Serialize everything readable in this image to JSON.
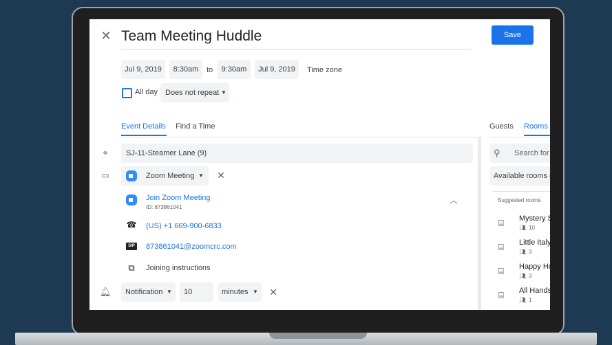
{
  "event": {
    "title": "Team Meeting Huddle",
    "save_label": "Save"
  },
  "datetime": {
    "start_date": "Jul 9, 2019",
    "start_time": "8:30am",
    "to_label": "to",
    "end_time": "9:30am",
    "end_date": "Jul 9, 2019",
    "timezone_label": "Time zone",
    "allday_label": "All day",
    "repeat_value": "Does not repeat"
  },
  "tabs": {
    "details": "Event Details",
    "find_time": "Find a Time"
  },
  "location": {
    "value": "SJ-11-Steamer Lane (9)"
  },
  "conference": {
    "type": "Zoom Meeting",
    "join_label": "Join Zoom Meeting",
    "meeting_id": "ID: 873861041",
    "phone": "(US) +1 669-900-6833",
    "sip": "873861041@zoomcrc.com",
    "sip_badge": "SIP",
    "instructions": "Joining instructions"
  },
  "notification": {
    "type": "Notification",
    "amount": "10",
    "unit": "minutes"
  },
  "right_panel": {
    "tab_guests": "Guests",
    "tab_rooms": "Rooms",
    "search_placeholder": "Search for",
    "available_rooms": "Available rooms c",
    "suggested_heading": "Suggested rooms",
    "rooms": [
      {
        "name": "Mystery S",
        "capacity": "10"
      },
      {
        "name": "Little Italy",
        "capacity": "3"
      },
      {
        "name": "Happy Ho",
        "capacity": "3"
      },
      {
        "name": "All Hands",
        "capacity": "1"
      }
    ]
  },
  "colors": {
    "accent": "#1a73e8",
    "zoom": "#2d8cff",
    "bezel": "#1f1f1f",
    "background": "#1e3a52"
  }
}
